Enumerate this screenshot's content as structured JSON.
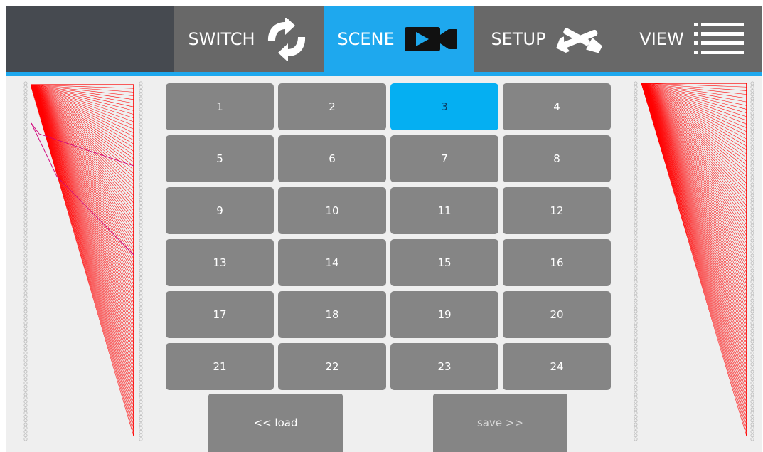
{
  "nav": {
    "tabs": [
      {
        "label": "SWITCH",
        "icon": "refresh-icon",
        "active": false
      },
      {
        "label": "SCENE",
        "icon": "video-camera-icon",
        "active": true
      },
      {
        "label": "SETUP",
        "icon": "tools-icon",
        "active": false
      },
      {
        "label": "VIEW",
        "icon": "list-icon",
        "active": false
      }
    ]
  },
  "scenes": {
    "buttons": [
      "1",
      "2",
      "3",
      "4",
      "5",
      "6",
      "7",
      "8",
      "9",
      "10",
      "11",
      "12",
      "13",
      "14",
      "15",
      "16",
      "17",
      "18",
      "19",
      "20",
      "21",
      "22",
      "23",
      "24"
    ],
    "selected": "3"
  },
  "actions": {
    "load_label": "<< load",
    "save_label": "save >>"
  },
  "colors": {
    "accent": "#1ea8ee",
    "selected_scene": "#05aff2",
    "button": "#858585",
    "nav_bar": "#686868",
    "brand_block": "#464a50",
    "routing_line": "#ff0000",
    "routing_highlight": "#d0007a"
  }
}
